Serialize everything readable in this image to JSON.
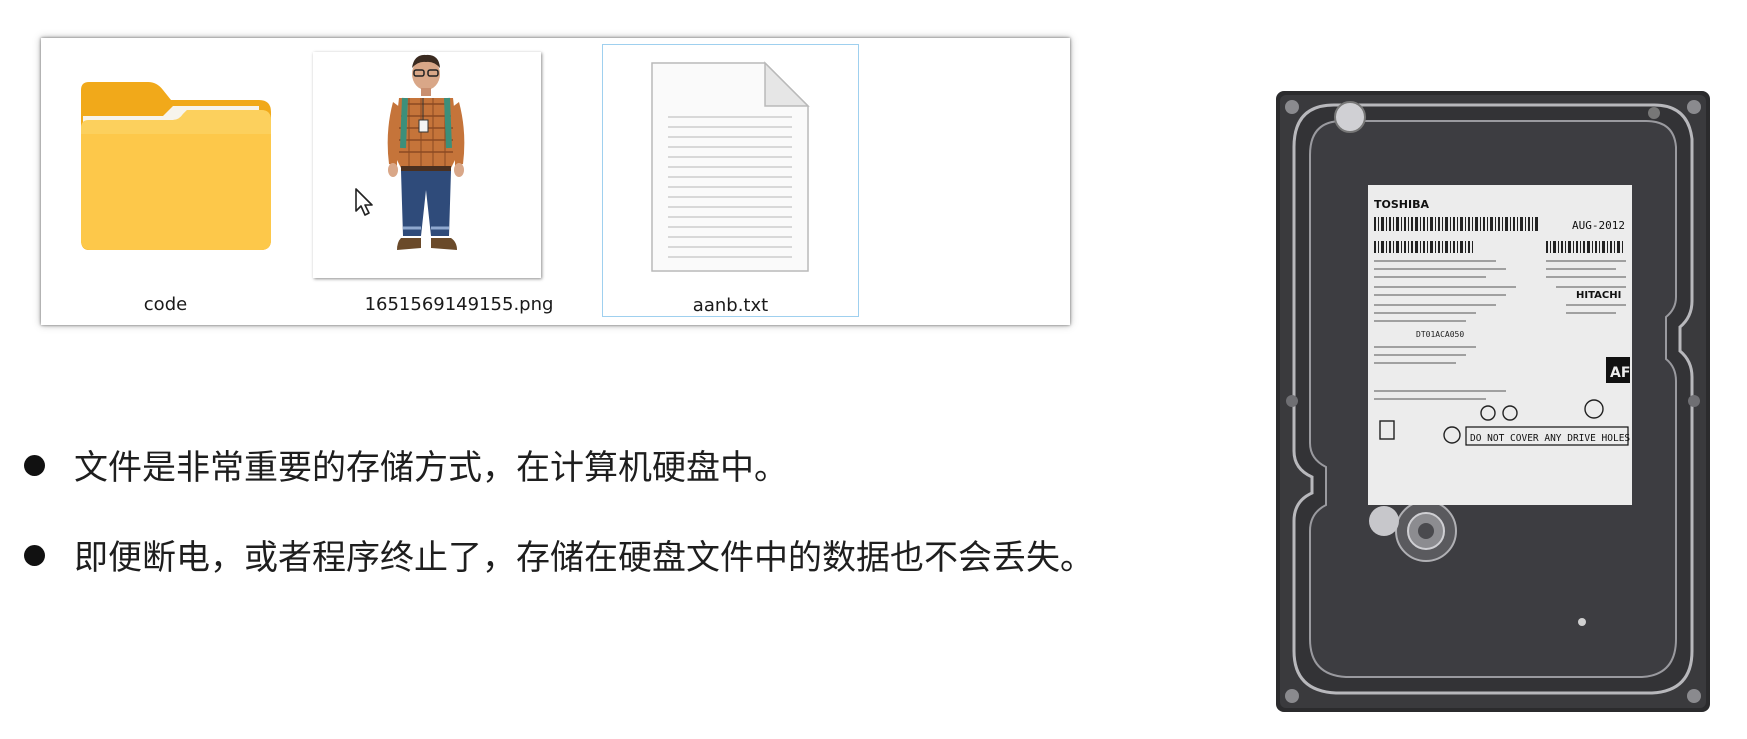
{
  "explorer": {
    "files": [
      {
        "name": "code",
        "icon": "folder-icon",
        "selected": false
      },
      {
        "name": "1651569149155.png",
        "icon": "image-thumbnail",
        "selected": false
      },
      {
        "name": "aanb.txt",
        "icon": "text-file-icon",
        "selected": true
      }
    ]
  },
  "bullets": [
    "文件是非常重要的存储方式，在计算机硬盘中。",
    "即便断电，或者程序终止了，存储在硬盘文件中的数据也不会丢失。"
  ],
  "hard_drive": {
    "brand": "TOSHIBA",
    "date": "AUG-2012",
    "secondary_brand": "HITACHI",
    "model": "DT01ACA050",
    "badge": "AF",
    "warning": "DO NOT COVER ANY DRIVE HOLES"
  },
  "colors": {
    "folder_back": "#f5b51f",
    "folder_front": "#fccb4f",
    "selection_border": "#9fd0ef",
    "drive_body": "#2b2b2d",
    "drive_label": "#ececec"
  }
}
